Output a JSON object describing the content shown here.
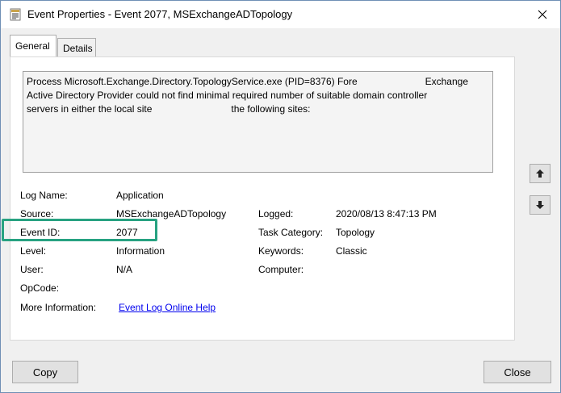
{
  "window": {
    "title": "Event Properties - Event 2077, MSExchangeADTopology",
    "icon": "event-properties-icon"
  },
  "tabs": [
    {
      "label": "General",
      "active": true
    },
    {
      "label": "Details",
      "active": false
    }
  ],
  "description": {
    "line1_a": "Process Microsoft.Exchange.Directory.TopologyService.exe (PID=8376) Fore",
    "line1_b": "Exchange",
    "line2": "Active Directory Provider could not find minimal required number of suitable domain controller",
    "line3_a": "servers in either the local site",
    "line3_b": "the following sites:"
  },
  "fields": {
    "log_name_label": "Log Name:",
    "log_name_value": "Application",
    "source_label": "Source:",
    "source_value": "MSExchangeADTopology",
    "logged_label": "Logged:",
    "logged_value": "2020/08/13 8:47:13 PM",
    "event_id_label": "Event ID:",
    "event_id_value": "2077",
    "task_category_label": "Task Category:",
    "task_category_value": "Topology",
    "level_label": "Level:",
    "level_value": "Information",
    "keywords_label": "Keywords:",
    "keywords_value": "Classic",
    "user_label": "User:",
    "user_value": "N/A",
    "computer_label": "Computer:",
    "opcode_label": "OpCode:",
    "more_info_label": "More Information:",
    "more_info_link": "Event Log Online Help"
  },
  "buttons": {
    "copy": "Copy",
    "close": "Close"
  },
  "colors": {
    "highlight": "#27a281",
    "link": "#0000ee"
  }
}
